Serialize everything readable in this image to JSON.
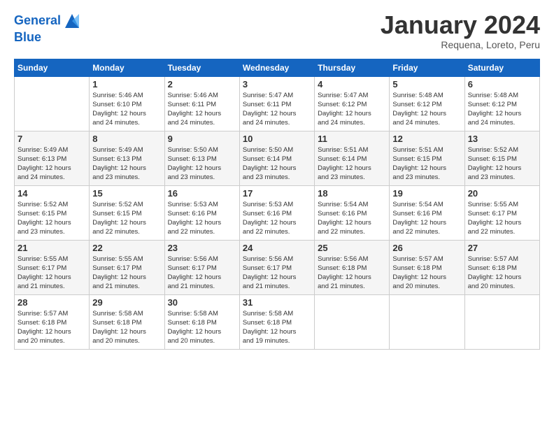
{
  "header": {
    "logo_line1": "General",
    "logo_line2": "Blue",
    "month": "January 2024",
    "location": "Requena, Loreto, Peru"
  },
  "days_of_week": [
    "Sunday",
    "Monday",
    "Tuesday",
    "Wednesday",
    "Thursday",
    "Friday",
    "Saturday"
  ],
  "weeks": [
    [
      {
        "num": "",
        "info": ""
      },
      {
        "num": "1",
        "info": "Sunrise: 5:46 AM\nSunset: 6:10 PM\nDaylight: 12 hours\nand 24 minutes."
      },
      {
        "num": "2",
        "info": "Sunrise: 5:46 AM\nSunset: 6:11 PM\nDaylight: 12 hours\nand 24 minutes."
      },
      {
        "num": "3",
        "info": "Sunrise: 5:47 AM\nSunset: 6:11 PM\nDaylight: 12 hours\nand 24 minutes."
      },
      {
        "num": "4",
        "info": "Sunrise: 5:47 AM\nSunset: 6:12 PM\nDaylight: 12 hours\nand 24 minutes."
      },
      {
        "num": "5",
        "info": "Sunrise: 5:48 AM\nSunset: 6:12 PM\nDaylight: 12 hours\nand 24 minutes."
      },
      {
        "num": "6",
        "info": "Sunrise: 5:48 AM\nSunset: 6:12 PM\nDaylight: 12 hours\nand 24 minutes."
      }
    ],
    [
      {
        "num": "7",
        "info": "Sunrise: 5:49 AM\nSunset: 6:13 PM\nDaylight: 12 hours\nand 24 minutes."
      },
      {
        "num": "8",
        "info": "Sunrise: 5:49 AM\nSunset: 6:13 PM\nDaylight: 12 hours\nand 23 minutes."
      },
      {
        "num": "9",
        "info": "Sunrise: 5:50 AM\nSunset: 6:13 PM\nDaylight: 12 hours\nand 23 minutes."
      },
      {
        "num": "10",
        "info": "Sunrise: 5:50 AM\nSunset: 6:14 PM\nDaylight: 12 hours\nand 23 minutes."
      },
      {
        "num": "11",
        "info": "Sunrise: 5:51 AM\nSunset: 6:14 PM\nDaylight: 12 hours\nand 23 minutes."
      },
      {
        "num": "12",
        "info": "Sunrise: 5:51 AM\nSunset: 6:15 PM\nDaylight: 12 hours\nand 23 minutes."
      },
      {
        "num": "13",
        "info": "Sunrise: 5:52 AM\nSunset: 6:15 PM\nDaylight: 12 hours\nand 23 minutes."
      }
    ],
    [
      {
        "num": "14",
        "info": "Sunrise: 5:52 AM\nSunset: 6:15 PM\nDaylight: 12 hours\nand 23 minutes."
      },
      {
        "num": "15",
        "info": "Sunrise: 5:52 AM\nSunset: 6:15 PM\nDaylight: 12 hours\nand 22 minutes."
      },
      {
        "num": "16",
        "info": "Sunrise: 5:53 AM\nSunset: 6:16 PM\nDaylight: 12 hours\nand 22 minutes."
      },
      {
        "num": "17",
        "info": "Sunrise: 5:53 AM\nSunset: 6:16 PM\nDaylight: 12 hours\nand 22 minutes."
      },
      {
        "num": "18",
        "info": "Sunrise: 5:54 AM\nSunset: 6:16 PM\nDaylight: 12 hours\nand 22 minutes."
      },
      {
        "num": "19",
        "info": "Sunrise: 5:54 AM\nSunset: 6:16 PM\nDaylight: 12 hours\nand 22 minutes."
      },
      {
        "num": "20",
        "info": "Sunrise: 5:55 AM\nSunset: 6:17 PM\nDaylight: 12 hours\nand 22 minutes."
      }
    ],
    [
      {
        "num": "21",
        "info": "Sunrise: 5:55 AM\nSunset: 6:17 PM\nDaylight: 12 hours\nand 21 minutes."
      },
      {
        "num": "22",
        "info": "Sunrise: 5:55 AM\nSunset: 6:17 PM\nDaylight: 12 hours\nand 21 minutes."
      },
      {
        "num": "23",
        "info": "Sunrise: 5:56 AM\nSunset: 6:17 PM\nDaylight: 12 hours\nand 21 minutes."
      },
      {
        "num": "24",
        "info": "Sunrise: 5:56 AM\nSunset: 6:17 PM\nDaylight: 12 hours\nand 21 minutes."
      },
      {
        "num": "25",
        "info": "Sunrise: 5:56 AM\nSunset: 6:18 PM\nDaylight: 12 hours\nand 21 minutes."
      },
      {
        "num": "26",
        "info": "Sunrise: 5:57 AM\nSunset: 6:18 PM\nDaylight: 12 hours\nand 20 minutes."
      },
      {
        "num": "27",
        "info": "Sunrise: 5:57 AM\nSunset: 6:18 PM\nDaylight: 12 hours\nand 20 minutes."
      }
    ],
    [
      {
        "num": "28",
        "info": "Sunrise: 5:57 AM\nSunset: 6:18 PM\nDaylight: 12 hours\nand 20 minutes."
      },
      {
        "num": "29",
        "info": "Sunrise: 5:58 AM\nSunset: 6:18 PM\nDaylight: 12 hours\nand 20 minutes."
      },
      {
        "num": "30",
        "info": "Sunrise: 5:58 AM\nSunset: 6:18 PM\nDaylight: 12 hours\nand 20 minutes."
      },
      {
        "num": "31",
        "info": "Sunrise: 5:58 AM\nSunset: 6:18 PM\nDaylight: 12 hours\nand 19 minutes."
      },
      {
        "num": "",
        "info": ""
      },
      {
        "num": "",
        "info": ""
      },
      {
        "num": "",
        "info": ""
      }
    ]
  ]
}
